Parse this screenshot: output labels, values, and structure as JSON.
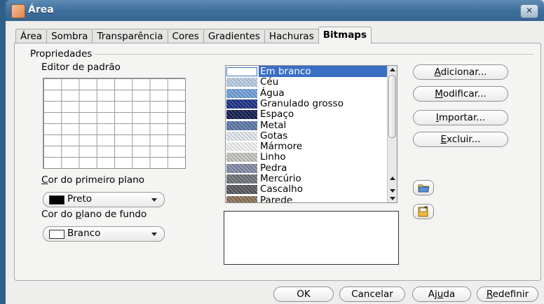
{
  "window": {
    "title": "Área",
    "close_glyph": "✕"
  },
  "tabs": [
    {
      "label": "Área",
      "active": false
    },
    {
      "label": "Sombra",
      "active": false
    },
    {
      "label": "Transparência",
      "active": false
    },
    {
      "label": "Cores",
      "active": false
    },
    {
      "label": "Gradientes",
      "active": false
    },
    {
      "label": "Hachuras",
      "active": false
    },
    {
      "label": "Bitmaps",
      "active": true
    }
  ],
  "group": {
    "title": "Propriedades"
  },
  "pattern_editor": {
    "label": "Editor de padrão"
  },
  "foreground": {
    "label": "Cor do primeiro plano",
    "value": "Preto",
    "swatch": "#000000"
  },
  "background": {
    "label": "Cor do plano de fundo",
    "value": "Branco",
    "swatch": "#ffffff"
  },
  "bitmaps": {
    "items": [
      {
        "label": "Em branco",
        "selected": true,
        "color": "#ffffff"
      },
      {
        "label": "Céu",
        "selected": false,
        "color": "#b9cde4"
      },
      {
        "label": "Água",
        "selected": false,
        "color": "#6f9fd8"
      },
      {
        "label": "Granulado grosso",
        "selected": false,
        "color": "#1b2f86"
      },
      {
        "label": "Espaço",
        "selected": false,
        "color": "#101a4e"
      },
      {
        "label": "Metal",
        "selected": false,
        "color": "#5b78a8"
      },
      {
        "label": "Gotas",
        "selected": false,
        "color": "#e4e9f0"
      },
      {
        "label": "Mármore",
        "selected": false,
        "color": "#f3f3f3"
      },
      {
        "label": "Linho",
        "selected": false,
        "color": "#c4c4c0"
      },
      {
        "label": "Pedra",
        "selected": false,
        "color": "#8189a4"
      },
      {
        "label": "Mercúrio",
        "selected": false,
        "color": "#6d7277"
      },
      {
        "label": "Cascalho",
        "selected": false,
        "color": "#55575a"
      },
      {
        "label": "Parede",
        "selected": false,
        "color": "#8a7254"
      }
    ]
  },
  "actions": {
    "add": "Adicionar...",
    "modify": "Modificar...",
    "import": "Importar...",
    "delete": "Excluir..."
  },
  "footer": {
    "ok": "OK",
    "cancel": "Cancelar",
    "help": "Ajuda",
    "reset": "Redefinir"
  },
  "icons": {
    "open": "folder-open-icon",
    "save": "save-icon"
  }
}
